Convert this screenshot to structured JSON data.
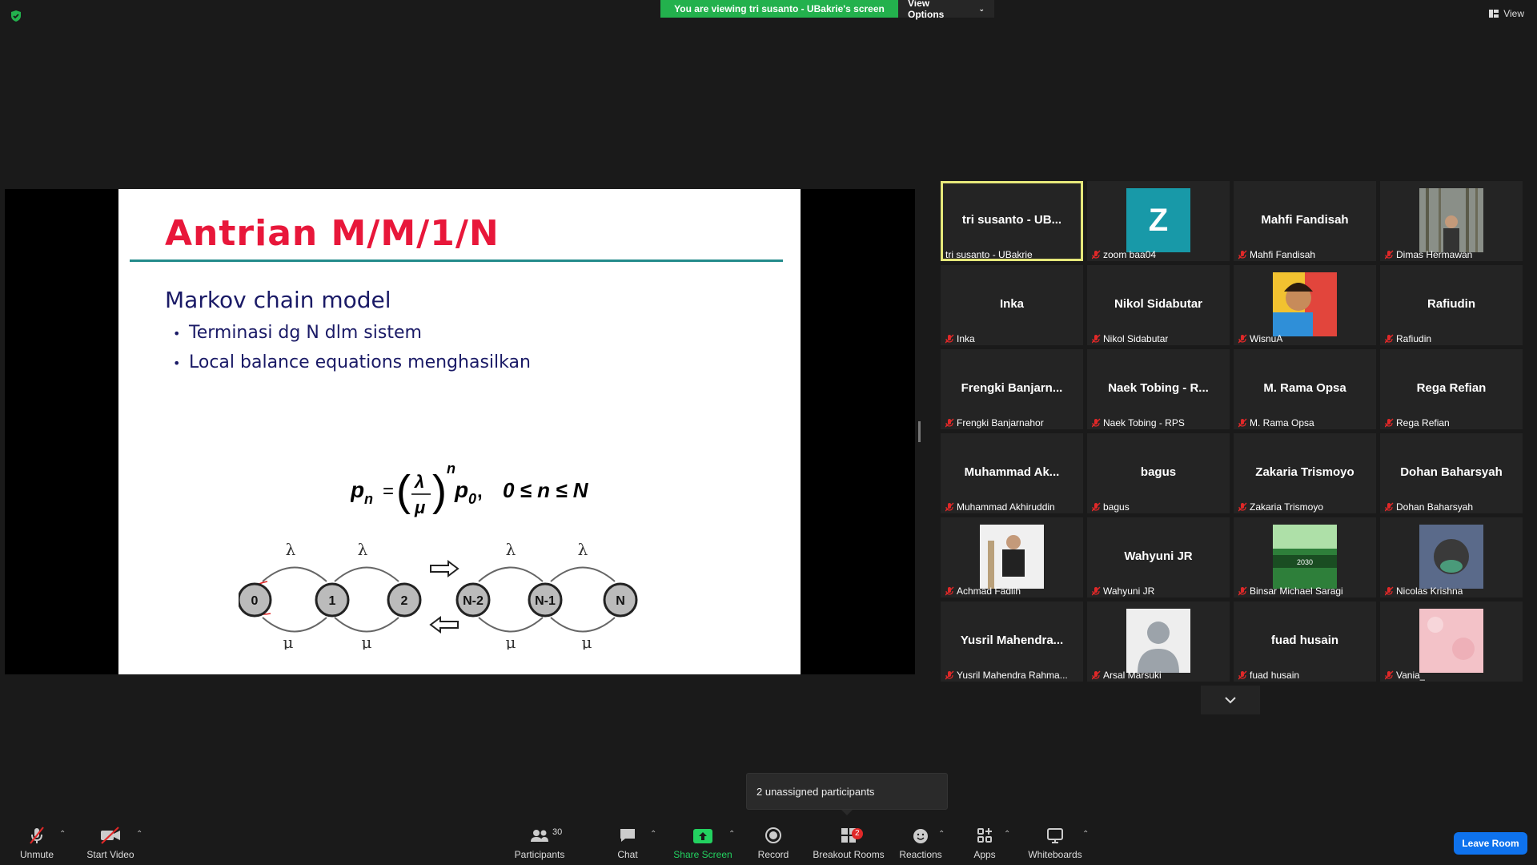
{
  "banner": {
    "viewing": "You are viewing tri susanto - UBakrie's screen",
    "options": "View Options"
  },
  "top_right": {
    "view": "View"
  },
  "slide": {
    "title": "Antrian M/M/1/N",
    "subtitle": "Markov chain model",
    "bullets": [
      "Terminasi dg N dlm sistem",
      "Local balance equations menghasilkan"
    ],
    "formula": {
      "lhs": "p",
      "lhs_sub": "n",
      "num": "λ",
      "den": "μ",
      "exp": "n",
      "p0": "p",
      "p0_sub": "0",
      "range": "0 ≤ n ≤ N"
    },
    "diagram": {
      "states": [
        "0",
        "1",
        "2",
        "N-2",
        "N-1",
        "N"
      ],
      "arrival": "λ",
      "service": "μ"
    }
  },
  "gallery": {
    "tiles": [
      {
        "big": "tri susanto - UB...",
        "label": "tri susanto - UBakrie",
        "active": true,
        "muted": false
      },
      {
        "avatar_letter": "Z",
        "label": "zoom baa04",
        "muted": true
      },
      {
        "big": "Mahfi Fandisah",
        "label": "Mahfi Fandisah",
        "muted": true
      },
      {
        "photo": "forest",
        "label": "Dimas Hermawan",
        "muted": true
      },
      {
        "big": "Inka",
        "label": "Inka",
        "muted": true
      },
      {
        "big": "Nikol Sidabutar",
        "label": "Nikol Sidabutar",
        "muted": true
      },
      {
        "photo": "art",
        "label": "WisnuA",
        "muted": true
      },
      {
        "big": "Rafiudin",
        "label": "Rafiudin",
        "muted": true
      },
      {
        "big": "Frengki  Banjarn...",
        "label": "Frengki Banjarnahor",
        "muted": true
      },
      {
        "big": "Naek Tobing - R...",
        "label": "Naek Tobing - RPS",
        "muted": true
      },
      {
        "big": "M. Rama Opsa",
        "label": "M. Rama Opsa",
        "muted": true
      },
      {
        "big": "Rega Refian",
        "label": "Rega Refian",
        "muted": true
      },
      {
        "big": "Muhammad  Ak...",
        "label": "Muhammad Akhiruddin",
        "muted": true
      },
      {
        "big": "bagus",
        "label": "bagus",
        "muted": true
      },
      {
        "big": "Zakaria Trismoyo",
        "label": "Zakaria Trismoyo",
        "muted": true
      },
      {
        "big": "Dohan Baharsyah",
        "label": "Dohan Baharsyah",
        "muted": true
      },
      {
        "photo": "suit",
        "label": "Achmad Fadlih",
        "muted": true
      },
      {
        "big": "Wahyuni JR",
        "label": "Wahyuni JR",
        "muted": true
      },
      {
        "photo": "green-poster",
        "label": "Binsar Michael Saragi",
        "muted": true
      },
      {
        "photo": "face",
        "label": "Nicolas Krishna",
        "muted": true
      },
      {
        "big": "Yusril  Mahendra...",
        "label": "Yusril Mahendra Rahma...",
        "muted": true
      },
      {
        "photo": "default",
        "label": "Arsal Marsuki",
        "muted": true
      },
      {
        "big": "fuad husain",
        "label": "fuad husain",
        "muted": true
      },
      {
        "photo": "pink",
        "label": "Vania_",
        "muted": true
      }
    ]
  },
  "tooltip": {
    "text": "2 unassigned participants"
  },
  "toolbar": {
    "unmute": "Unmute",
    "start_video": "Start Video",
    "participants": "Participants",
    "participants_count": "30",
    "chat": "Chat",
    "share_screen": "Share Screen",
    "record": "Record",
    "breakout": "Breakout Rooms",
    "breakout_badge": "2",
    "reactions": "Reactions",
    "apps": "Apps",
    "whiteboards": "Whiteboards",
    "leave": "Leave Room"
  },
  "colors": {
    "accent_green": "#23b14d",
    "leave_blue": "#0e72ed",
    "title_red": "#e8173a",
    "active_border": "#e6e87a"
  }
}
